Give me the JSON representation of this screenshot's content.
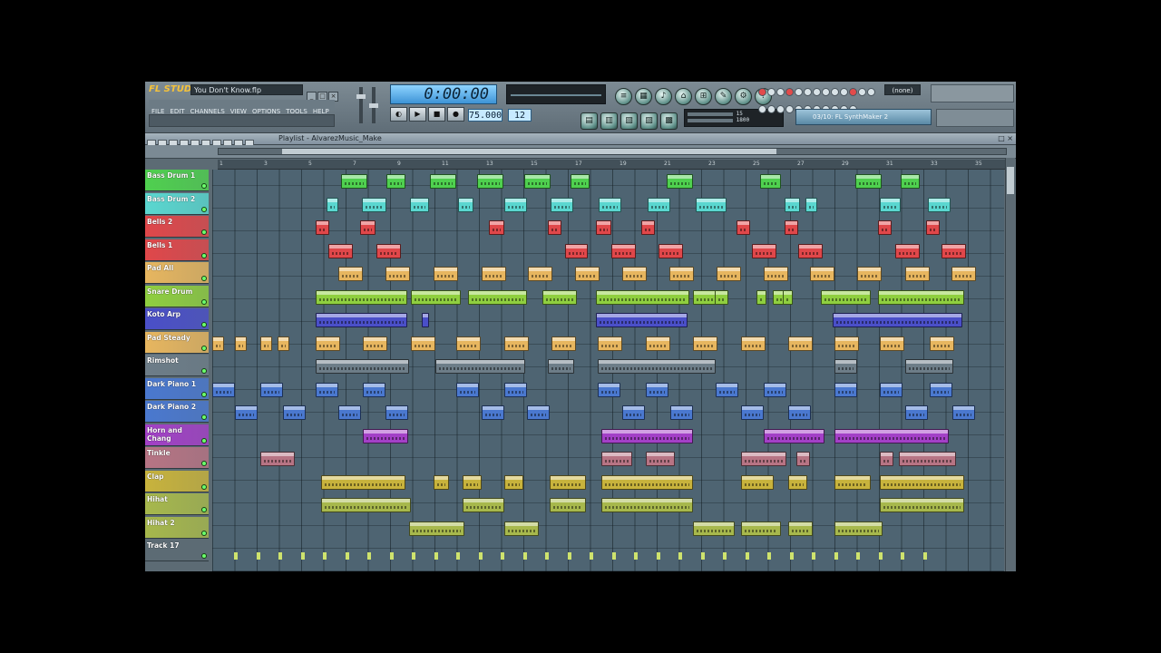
{
  "app": {
    "logo": "FL STUDIO",
    "song_title": "You Don't Know.flp",
    "time": "0:00:00",
    "tempo": "75.000",
    "pattern": "12",
    "plugin": "03/10: FL SynthMaker 2",
    "output_select": "(none)",
    "cpu_labels": [
      "15",
      "1800"
    ]
  },
  "menu": [
    "FILE",
    "EDIT",
    "CHANNELS",
    "VIEW",
    "OPTIONS",
    "TOOLS",
    "HELP"
  ],
  "playlist": {
    "title": "Playlist - AlvarezMusic_Make",
    "ruler": [
      "1",
      "3",
      "5",
      "7",
      "9",
      "11",
      "13",
      "15",
      "17",
      "19",
      "21",
      "23",
      "25",
      "27",
      "29",
      "31",
      "33",
      "35"
    ]
  },
  "tracks": [
    {
      "name": "Bass Drum 1",
      "color": "#4fd04f"
    },
    {
      "name": "Bass Drum 2",
      "color": "#5ad7d0"
    },
    {
      "name": "Bells 2",
      "color": "#e0474a"
    },
    {
      "name": "Bells 1",
      "color": "#e0474a"
    },
    {
      "name": "Pad All",
      "color": "#e7b65f"
    },
    {
      "name": "Snare Drum",
      "color": "#8fcf3f"
    },
    {
      "name": "Koto Arp",
      "color": "#4a4fc8"
    },
    {
      "name": "Pad Steady",
      "color": "#e7b65f"
    },
    {
      "name": "Rimshot",
      "color": "#6d7d88"
    },
    {
      "name": "Dark Piano 1",
      "color": "#4a78cf"
    },
    {
      "name": "Dark Piano 2",
      "color": "#4a78cf"
    },
    {
      "name": "Horn and Chang",
      "color": "#a340c7"
    },
    {
      "name": "Tinkle",
      "color": "#b77484"
    },
    {
      "name": "Clap",
      "color": "#c8b33c"
    },
    {
      "name": "Hihat",
      "color": "#a7b84c"
    },
    {
      "name": "Hihat 2",
      "color": "#a7b84c"
    },
    {
      "name": "Track 17",
      "color": "#5c6b74"
    }
  ]
}
